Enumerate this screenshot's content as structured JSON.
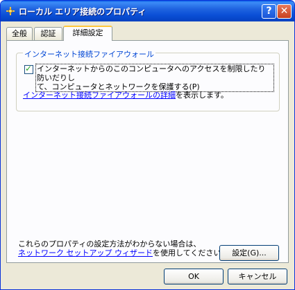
{
  "window": {
    "title": "ローカル エリア接続のプロパティ",
    "help_symbol": "?",
    "close_symbol": "✕"
  },
  "tabs": [
    {
      "label": "全般"
    },
    {
      "label": "認証"
    },
    {
      "label": "詳細設定"
    }
  ],
  "firewall_group": {
    "title": "インターネット接続ファイアウォール",
    "checkbox_checked": true,
    "checkbox_line1": "インターネットからのこのコンピュータへのアクセスを制限したり防いだりし",
    "checkbox_line2": "て、コンピュータとネットワークを保護する(P)",
    "detail_link": "インターネット接続ファイアウォールの詳細",
    "detail_suffix": "を表示します。"
  },
  "footer_note": {
    "line1": "これらのプロパティの設定方法がわからない場合は、",
    "wizard_link": "ネットワーク セットアップ ウィザード",
    "line2_suffix": "を使用してください。"
  },
  "buttons": {
    "settings": "設定(G)...",
    "ok": "OK",
    "cancel": "キャンセル"
  }
}
